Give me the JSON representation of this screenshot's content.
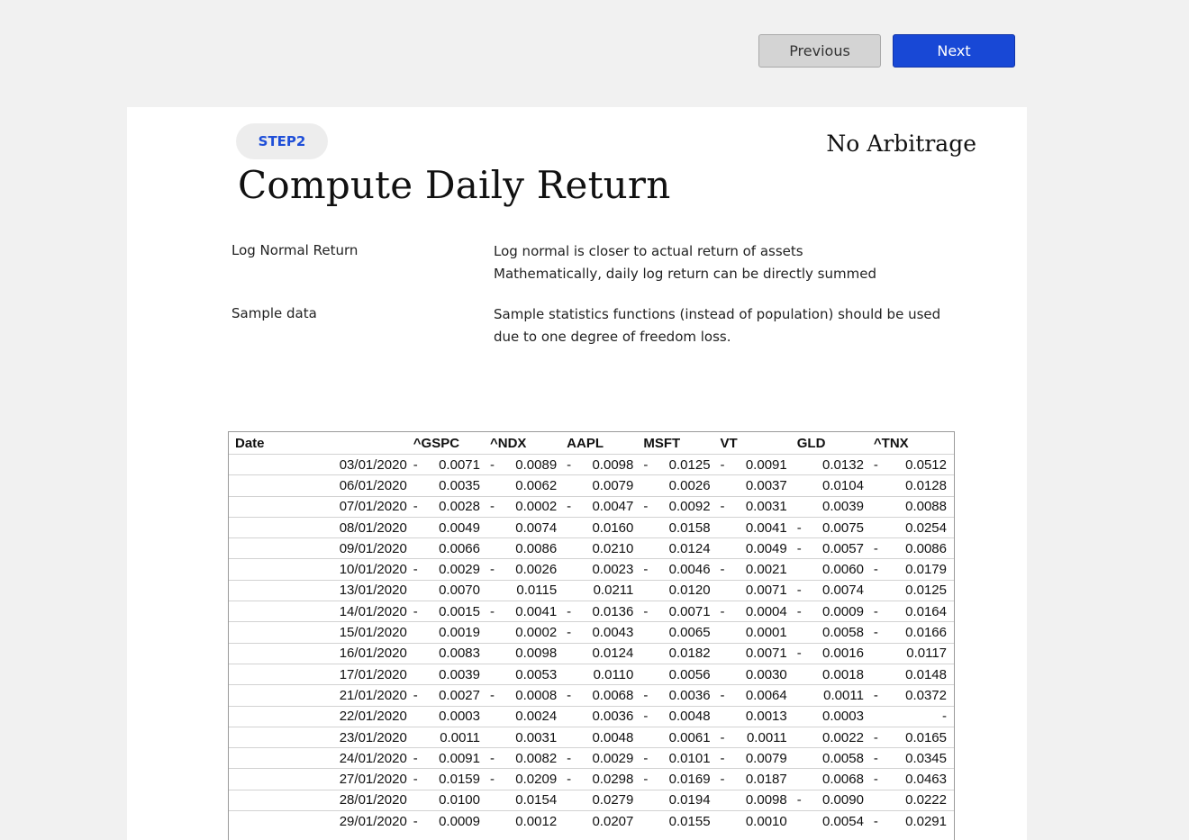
{
  "nav": {
    "previous_label": "Previous",
    "next_label": "Next"
  },
  "slide": {
    "step_label": "STEP2",
    "brand": "No Arbitrage",
    "title": "Compute Daily Return",
    "sections": [
      {
        "label": "Log Normal Return",
        "lines": [
          "Log normal is closer to actual return of assets",
          "Mathematically, daily log return can be directly summed"
        ]
      },
      {
        "label": "Sample data",
        "lines": [
          "Sample statistics functions (instead of population) should be used",
          "due to one degree of freedom loss."
        ]
      }
    ]
  },
  "table": {
    "headers": [
      "Date",
      "^GSPC",
      "^NDX",
      "AAPL",
      "MSFT",
      "VT",
      "GLD",
      "^TNX"
    ],
    "rows": [
      [
        "03/01/2020",
        "-",
        "0.0071",
        "-",
        "0.0089",
        "-",
        "0.0098",
        "-",
        "0.0125",
        "-",
        "0.0091",
        "",
        "0.0132",
        "-",
        "0.0512"
      ],
      [
        "06/01/2020",
        "",
        "0.0035",
        "",
        "0.0062",
        "",
        "0.0079",
        "",
        "0.0026",
        "",
        "0.0037",
        "",
        "0.0104",
        "",
        "0.0128"
      ],
      [
        "07/01/2020",
        "-",
        "0.0028",
        "-",
        "0.0002",
        "-",
        "0.0047",
        "-",
        "0.0092",
        "-",
        "0.0031",
        "",
        "0.0039",
        "",
        "0.0088"
      ],
      [
        "08/01/2020",
        "",
        "0.0049",
        "",
        "0.0074",
        "",
        "0.0160",
        "",
        "0.0158",
        "",
        "0.0041",
        "-",
        "0.0075",
        "",
        "0.0254"
      ],
      [
        "09/01/2020",
        "",
        "0.0066",
        "",
        "0.0086",
        "",
        "0.0210",
        "",
        "0.0124",
        "",
        "0.0049",
        "-",
        "0.0057",
        "-",
        "0.0086"
      ],
      [
        "10/01/2020",
        "-",
        "0.0029",
        "-",
        "0.0026",
        "",
        "0.0023",
        "-",
        "0.0046",
        "-",
        "0.0021",
        "",
        "0.0060",
        "-",
        "0.0179"
      ],
      [
        "13/01/2020",
        "",
        "0.0070",
        "",
        "0.0115",
        "",
        "0.0211",
        "",
        "0.0120",
        "",
        "0.0071",
        "-",
        "0.0074",
        "",
        "0.0125"
      ],
      [
        "14/01/2020",
        "-",
        "0.0015",
        "-",
        "0.0041",
        "-",
        "0.0136",
        "-",
        "0.0071",
        "-",
        "0.0004",
        "-",
        "0.0009",
        "-",
        "0.0164"
      ],
      [
        "15/01/2020",
        "",
        "0.0019",
        "",
        "0.0002",
        "-",
        "0.0043",
        "",
        "0.0065",
        "",
        "0.0001",
        "",
        "0.0058",
        "-",
        "0.0166"
      ],
      [
        "16/01/2020",
        "",
        "0.0083",
        "",
        "0.0098",
        "",
        "0.0124",
        "",
        "0.0182",
        "",
        "0.0071",
        "-",
        "0.0016",
        "",
        "0.0117"
      ],
      [
        "17/01/2020",
        "",
        "0.0039",
        "",
        "0.0053",
        "",
        "0.0110",
        "",
        "0.0056",
        "",
        "0.0030",
        "",
        "0.0018",
        "",
        "0.0148"
      ],
      [
        "21/01/2020",
        "-",
        "0.0027",
        "-",
        "0.0008",
        "-",
        "0.0068",
        "-",
        "0.0036",
        "-",
        "0.0064",
        "",
        "0.0011",
        "-",
        "0.0372"
      ],
      [
        "22/01/2020",
        "",
        "0.0003",
        "",
        "0.0024",
        "",
        "0.0036",
        "-",
        "0.0048",
        "",
        "0.0013",
        "",
        "0.0003",
        "",
        "-"
      ],
      [
        "23/01/2020",
        "",
        "0.0011",
        "",
        "0.0031",
        "",
        "0.0048",
        "",
        "0.0061",
        "-",
        "0.0011",
        "",
        "0.0022",
        "-",
        "0.0165"
      ],
      [
        "24/01/2020",
        "-",
        "0.0091",
        "-",
        "0.0082",
        "-",
        "0.0029",
        "-",
        "0.0101",
        "-",
        "0.0079",
        "",
        "0.0058",
        "-",
        "0.0345"
      ],
      [
        "27/01/2020",
        "-",
        "0.0159",
        "-",
        "0.0209",
        "-",
        "0.0298",
        "-",
        "0.0169",
        "-",
        "0.0187",
        "",
        "0.0068",
        "-",
        "0.0463"
      ],
      [
        "28/01/2020",
        "",
        "0.0100",
        "",
        "0.0154",
        "",
        "0.0279",
        "",
        "0.0194",
        "",
        "0.0098",
        "-",
        "0.0090",
        "",
        "0.0222"
      ],
      [
        "29/01/2020",
        "-",
        "0.0009",
        "",
        "0.0012",
        "",
        "0.0207",
        "",
        "0.0155",
        "",
        "0.0010",
        "",
        "0.0054",
        "-",
        "0.0291"
      ]
    ]
  }
}
